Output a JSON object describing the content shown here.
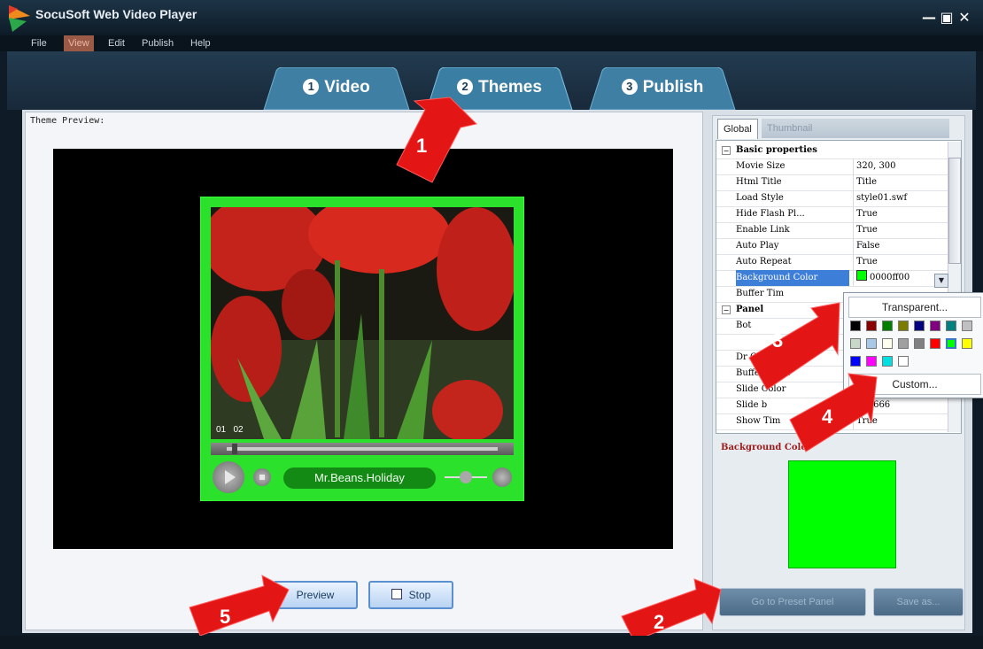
{
  "window": {
    "title": "SocuSoft Web Video Player",
    "minimize": "—",
    "maximize": "▣",
    "close": "✕"
  },
  "menu": [
    "File",
    "View",
    "Edit",
    "Publish",
    "Help"
  ],
  "tabs": [
    {
      "num": "1",
      "label": "Video"
    },
    {
      "num": "2",
      "label": "Themes"
    },
    {
      "num": "3",
      "label": "Publish"
    }
  ],
  "preview": {
    "label": "Theme Preview:",
    "time_left": "01",
    "time_right": "02",
    "movie_title": "Mr.Beans.Holiday"
  },
  "buttons": {
    "preview": "Preview",
    "stop": "Stop",
    "preset": "Go to Preset Panel",
    "save_as": "Save as..."
  },
  "right_tabs": [
    "Global",
    "Thumbnail"
  ],
  "properties": {
    "cat_basic": "Basic properties",
    "cat_panel": "Panel",
    "rows": [
      {
        "name": "Movie Size",
        "value": "320, 300"
      },
      {
        "name": "Html Title",
        "value": "Title"
      },
      {
        "name": "Load Style",
        "value": "style01.swf"
      },
      {
        "name": "Hide Flash Pl...",
        "value": "True"
      },
      {
        "name": "Enable Link",
        "value": "True"
      },
      {
        "name": "Auto Play",
        "value": "False"
      },
      {
        "name": "Auto Repeat",
        "value": "True"
      },
      {
        "name": "Background Color",
        "value": "0000ff00"
      },
      {
        "name": "Buffer Tim",
        "value": ""
      }
    ],
    "panel_rows": [
      {
        "name": "Bot",
        "value": ""
      },
      {
        "name": "",
        "value": ""
      },
      {
        "name": "Dr    Color",
        "value": ""
      },
      {
        "name": "Buffer Color",
        "value": ""
      },
      {
        "name": "Slide Color",
        "value": ""
      },
      {
        "name": "Slide b",
        "value": "666666"
      },
      {
        "name": "Show Tim",
        "value": "True"
      }
    ]
  },
  "description_title": "Background Color",
  "color_popup": {
    "transparent": "Transparent...",
    "custom": "Custom...",
    "colors": [
      "#000000",
      "#8b0000",
      "#008000",
      "#7b7b00",
      "#000080",
      "#800080",
      "#008080",
      "#c0c0c0",
      "#c8d8c8",
      "#a8c8e8",
      "#fffff0",
      "#a0a0a0",
      "#808080",
      "#ff0000",
      "#00ff00",
      "#ffff00",
      "#0000ff",
      "#ff00ff",
      "#00e0e0",
      "#ffffff"
    ]
  },
  "annotations": [
    "1",
    "2",
    "3",
    "4",
    "5"
  ],
  "colors": {
    "accent_green": "#00ff00",
    "player_green": "#2be12b",
    "annotation_red": "#e41515"
  }
}
